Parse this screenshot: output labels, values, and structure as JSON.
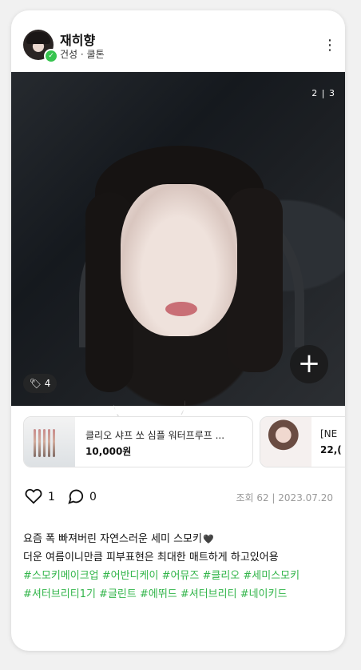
{
  "header": {
    "username": "재히향",
    "subinfo": "건성 · 쿨톤"
  },
  "photo": {
    "counter": "2 | 3",
    "tag_count": "4"
  },
  "products": [
    {
      "name": "클리오 샤프 쏘 심플 워터프루프 ...",
      "price": "10,000원"
    },
    {
      "name": "[NE",
      "price": "22,("
    }
  ],
  "actions": {
    "likes": "1",
    "comments": "0",
    "meta": "조회 62 | 2023.07.20"
  },
  "caption": {
    "line1": "요즘 폭 빠져버린 자연스러운 세미 스모키",
    "line2": "더운 여름이니만큼 피부표현은 최대한 매트하게 하고있어용",
    "hashtags1": "#스모키메이크업 #어반디케이 #어뮤즈 #클리오 #세미스모키",
    "hashtags2": "#셔터브리티1기 #글린트 #에뛰드 #셔터브리티 #네이키드"
  },
  "colors": {
    "accent": "#32b54a",
    "meta": "#999999"
  }
}
